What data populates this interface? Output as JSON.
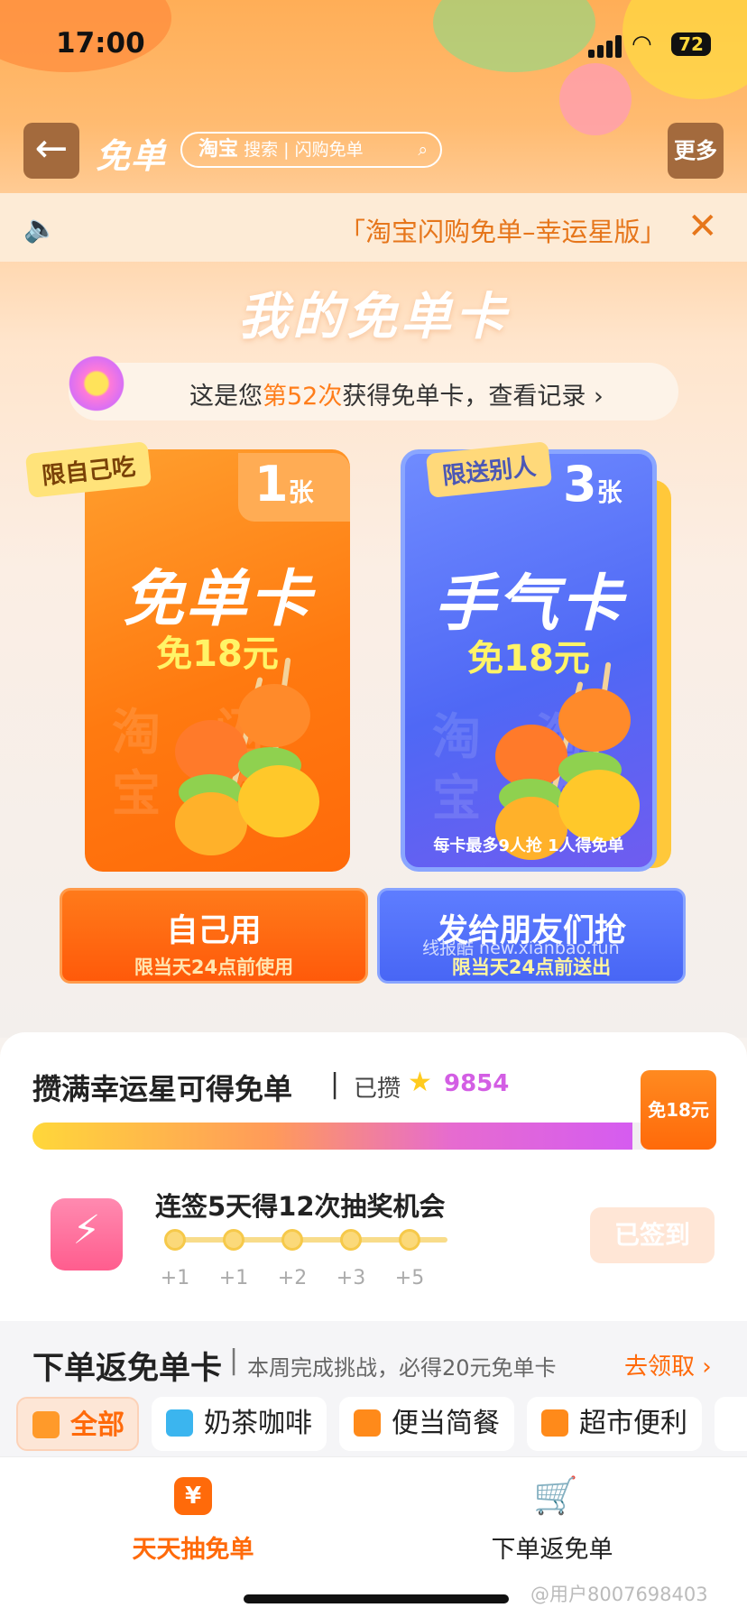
{
  "status_bar": {
    "time": "17:00",
    "battery": "72"
  },
  "nav": {
    "back_icon": "←",
    "title": "免单",
    "search_brand": "淘宝",
    "search_label": "搜索",
    "search_hint": "闪购免单",
    "search_icon": "⌕",
    "more_label": "更多"
  },
  "notice": {
    "speaker_icon": "🔈",
    "text": "「淘宝闪购免单–幸运星版」",
    "close_icon": "✕"
  },
  "section_title": "我的免单卡",
  "record": {
    "prefix": "这是您",
    "highlight": "第52次",
    "suffix": "获得免单卡，查看记录 ›"
  },
  "cards": {
    "self": {
      "tag": "限自己吃",
      "count": "1",
      "unit": "张",
      "name": "免单卡",
      "value": "免18元",
      "watermark": "淘闪宝购"
    },
    "gift": {
      "tag": "限送别人",
      "count": "3",
      "unit": "张",
      "name": "手气卡",
      "value": "免18元",
      "watermark": "淘淘宝购",
      "note": "每卡最多9人抢 1人得免单"
    }
  },
  "buttons": {
    "self": {
      "label": "自己用",
      "sub": "限当天24点前使用"
    },
    "friend": {
      "label": "发给朋友们抢",
      "sub": "限当天24点前送出"
    }
  },
  "watermark_mid": "线报酷 new.xianbao.fun",
  "lucky": {
    "title": "攒满幸运星可得免单",
    "sep": "|",
    "collected_label": "已攒",
    "star_icon": "★",
    "count": "9854",
    "progress": 0.88,
    "prize": "免18元"
  },
  "signin": {
    "icon": "⚡",
    "title": "连签5天得12次抽奖机会",
    "rewards": [
      "+1",
      "+1",
      "+2",
      "+3",
      "+5"
    ],
    "button": "已签到"
  },
  "order": {
    "title": "下单返免单卡",
    "sep": "|",
    "desc": "本周完成挑战，必得20元免单卡",
    "link": "去领取 ›"
  },
  "categories": [
    {
      "label": "全部",
      "color": "#ff9a2a"
    },
    {
      "label": "奶茶咖啡",
      "color": "#3bb5ef"
    },
    {
      "label": "便当简餐",
      "color": "#ff8a1a"
    },
    {
      "label": "超市便利",
      "color": "#ff8a1a"
    }
  ],
  "tabs": [
    {
      "label": "天天抽免单",
      "icon": "¥"
    },
    {
      "label": "下单返免单",
      "icon": "🛒"
    }
  ],
  "user_mark": "@用户8007698403",
  "colors": {
    "accent": "#ff6a0a",
    "blue": "#4f68f5",
    "star_purple": "#d35ee4"
  }
}
